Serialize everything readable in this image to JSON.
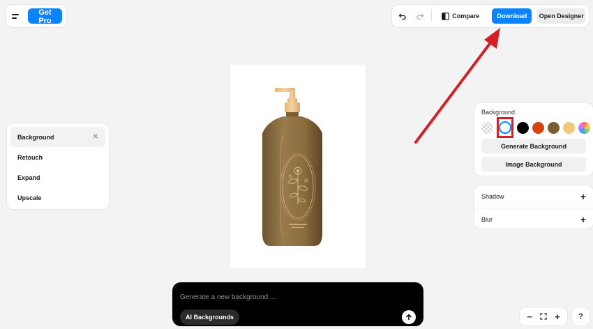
{
  "header": {
    "get_pro_label": "Get Pro"
  },
  "toolbar": {
    "compare_label": "Compare",
    "download_label": "Download",
    "open_designer_label": "Open Designer"
  },
  "tools": [
    {
      "label": "Background",
      "active": true
    },
    {
      "label": "Retouch"
    },
    {
      "label": "Expand"
    },
    {
      "label": "Upscale"
    }
  ],
  "background_panel": {
    "title": "Background",
    "swatches": [
      "#transparent",
      "#ffffff",
      "#000000",
      "#d5440d",
      "#7d5c2f",
      "#f1c77d",
      "rainbow"
    ],
    "generate_label": "Generate Background",
    "image_label": "Image Background"
  },
  "effects": {
    "shadow_label": "Shadow",
    "blur_label": "Blur"
  },
  "prompt": {
    "placeholder": "Generate a new background ...",
    "chip_label": "AI Backgrounds"
  },
  "zoom": {
    "help_label": "?"
  },
  "colors": {
    "accent": "#0a84ff",
    "annotation": "#d32027",
    "product": "#8d7044"
  }
}
